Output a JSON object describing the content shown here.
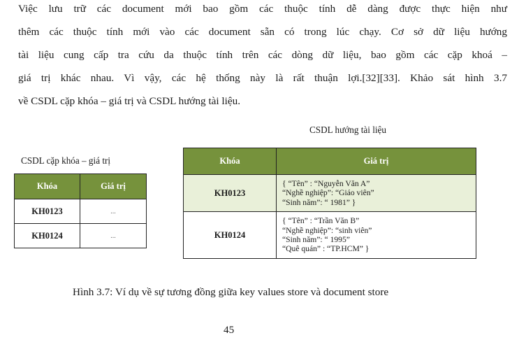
{
  "paragraph": {
    "lines": [
      "Việc lưu trữ các document mới bao gồm các thuộc tính dễ dàng được thực hiện như",
      "thêm các thuộc tính mới vào các document sẵn có trong lúc chạy. Cơ sở dữ liệu hướng",
      "tài liệu cung cấp tra cứu da thuộc tính trên các dòng dữ liệu, bao gồm các cặp khoá –",
      "giá trị khác nhau. Vì vậy, các hệ thống này là rất thuận lợi.[32][33]. Khảo sát hình 3.7",
      "về CSDL cặp khóa – giá trị và CSDL hướng tài liệu."
    ]
  },
  "doc_store": {
    "title": "CSDL hướng tài liệu",
    "header_key": "Khóa",
    "header_value": "Giá trị",
    "rows": [
      {
        "key": "KH0123",
        "value_lines": [
          "{    “Tên” : “Nguyễn Văn A”",
          "       “Nghề nghiệp”: “Giáo viên”",
          "    “Sinh năm”: “ 1981” }"
        ]
      },
      {
        "key": "KH0124",
        "value_lines": [
          "{    “Tên” : “Trần Văn B”",
          "   “Nghề nghiệp”: “sinh viên”",
          "    “Sinh năm”: “ 1995”",
          "   “Quê quán” : “TP.HCM” }"
        ]
      }
    ]
  },
  "kv_store": {
    "title": "CSDL cặp khóa – giá trị",
    "header_key": "Khóa",
    "header_value": "Giá trị",
    "rows": [
      {
        "key": "KH0123",
        "value": "..."
      },
      {
        "key": "KH0124",
        "value": "..."
      }
    ]
  },
  "colors": {
    "header_green": "#76923c",
    "row_highlight": "#e9f0d9"
  },
  "caption": "Hình 3.7: Ví dụ về sự tương đồng giữa key values store và document store",
  "page_number": "45"
}
